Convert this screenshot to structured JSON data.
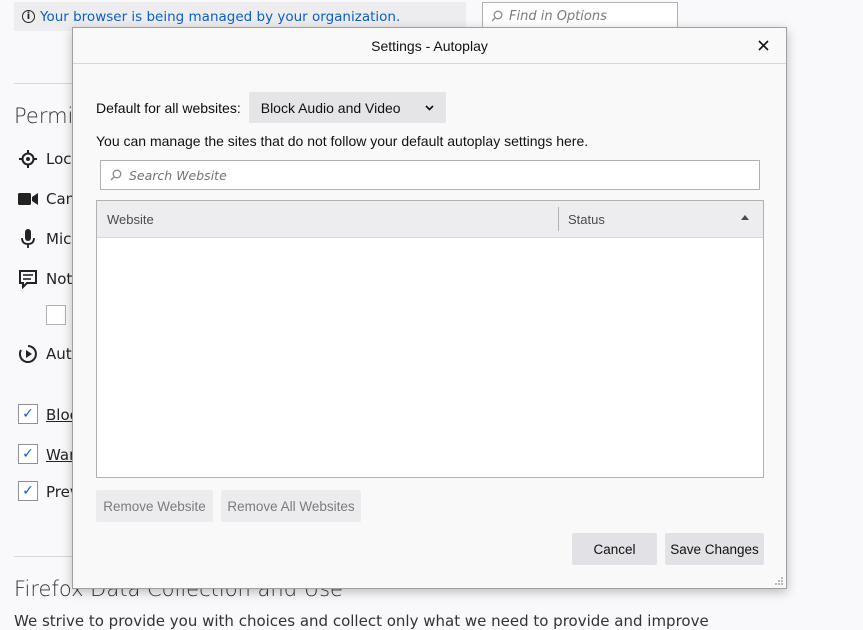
{
  "background": {
    "notice": "Your browser is being managed by your organization.",
    "find_placeholder": "Find in Options",
    "permissions_heading": "Permis",
    "permissions": [
      {
        "label": "Loca",
        "icon": "location-icon"
      },
      {
        "label": "Cam",
        "icon": "camera-icon"
      },
      {
        "label": "Micr",
        "icon": "microphone-icon"
      },
      {
        "label": "Not",
        "icon": "notification-icon"
      },
      {
        "label": "Auto",
        "icon": "autoplay-icon"
      }
    ],
    "checkboxes": [
      {
        "label": "Bloc",
        "checked": true
      },
      {
        "label": "War",
        "checked": true
      },
      {
        "label": "Prev",
        "checked": true
      }
    ],
    "section_heading": "Firefox Data Collection and Use",
    "section_text": "We strive to provide you with choices and collect only what we need to provide and improve"
  },
  "dialog": {
    "title": "Settings - Autoplay",
    "default_label": "Default for all websites:",
    "default_value": "Block Audio and Video",
    "manage_text": "You can manage the sites that do not follow your default autoplay settings here.",
    "search_placeholder": "Search Website",
    "columns": {
      "website": "Website",
      "status": "Status"
    },
    "rows": [],
    "remove_website": "Remove Website",
    "remove_all": "Remove All Websites",
    "cancel": "Cancel",
    "save": "Save Changes"
  }
}
